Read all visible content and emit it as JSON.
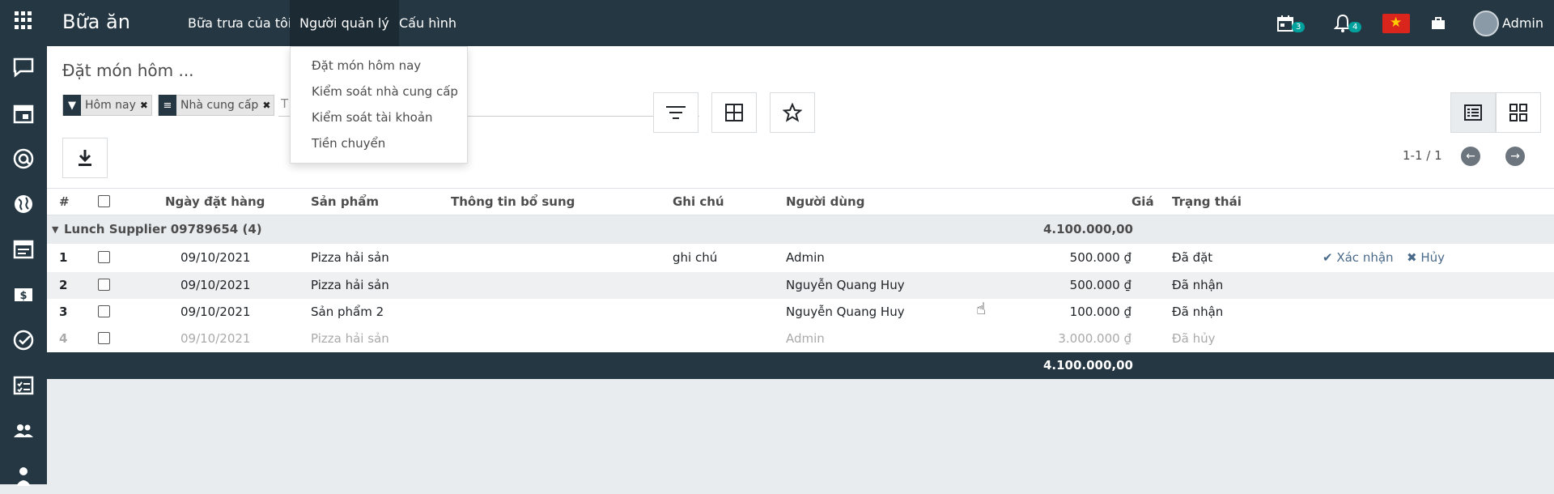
{
  "topbar": {
    "app_title": "Bữa ăn",
    "menus": [
      "Bữa trưa của tôi",
      "Người quản lý",
      "Cấu hình"
    ],
    "activity_count": "3",
    "notification_count": "4",
    "user_name": "Admin"
  },
  "dropdown": {
    "items": [
      "Đặt món hôm nay",
      "Kiểm soát nhà cung cấp",
      "Kiểm soát tài khoản",
      "Tiền chuyển"
    ]
  },
  "control_panel": {
    "breadcrumb": "Đặt món hôm ...",
    "facets": [
      {
        "label": "Hôm nay",
        "icon": "filter-icon"
      },
      {
        "label": "Nhà cung cấp",
        "icon": "group-by-icon"
      }
    ],
    "search_placeholder_fragment": "T",
    "pager": "1-1 / 1"
  },
  "table": {
    "headers": [
      "#",
      "Ngày đặt hàng",
      "Sản phẩm",
      "Thông tin bổ sung",
      "Ghi chú",
      "Người dùng",
      "Giá",
      "Trạng thái"
    ],
    "group": {
      "label": "Lunch Supplier 09789654 (4)",
      "total": "4.100.000,00"
    },
    "rows": [
      {
        "num": "1",
        "date": "09/10/2021",
        "product": "Pizza hải sản",
        "extra": "",
        "note": "ghi chú",
        "user": "Admin",
        "price": "500.000 ₫",
        "state": "Đã đặt",
        "confirm": "Xác nhận",
        "cancel": "Hủy"
      },
      {
        "num": "2",
        "date": "09/10/2021",
        "product": "Pizza hải sản",
        "extra": "",
        "note": "",
        "user": "Nguyễn Quang Huy",
        "price": "500.000 ₫",
        "state": "Đã nhận"
      },
      {
        "num": "3",
        "date": "09/10/2021",
        "product": "Sản phẩm 2",
        "extra": "",
        "note": "",
        "user": "Nguyễn Quang Huy",
        "price": "100.000 ₫",
        "state": "Đã nhận"
      },
      {
        "num": "4",
        "date": "09/10/2021",
        "product": "Pizza hải sản",
        "extra": "",
        "note": "",
        "user": "Admin",
        "price": "3.000.000 ₫",
        "state": "Đã hủy"
      }
    ],
    "footer_total": "4.100.000,00"
  },
  "colors": {
    "navbar": "#243742",
    "badge": "#00a09d"
  }
}
